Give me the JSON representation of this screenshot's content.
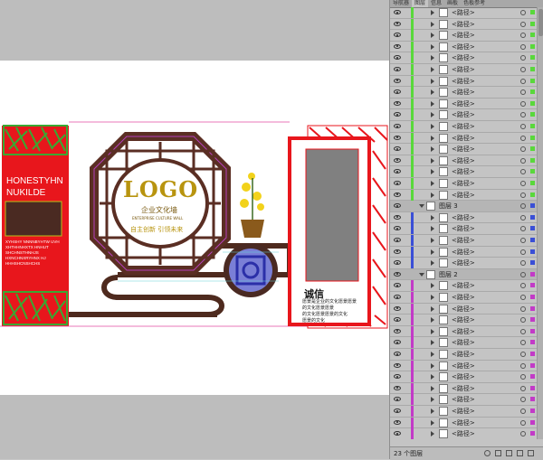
{
  "panel": {
    "tabs": [
      "导航器",
      "图层",
      "信息",
      "画板",
      "色板参考"
    ],
    "active_tab": "图层",
    "layer_count": "23 个图层",
    "path_label": "<路径>",
    "groups": [
      {
        "label": "图层 3"
      },
      {
        "label": "图层 2"
      }
    ],
    "colors": {
      "layer1": "#59d83b",
      "layer3": "#3a4fd6",
      "layer2": "#c23ac7"
    }
  },
  "artwork": {
    "left_panel_title_line1": "HONESTYHN",
    "left_panel_title_line2": "NUKILDE",
    "left_panel_small_text": [
      "XYHSHY NNNNBYHTW UVH",
      "XHTHHNHXTX HNHUT",
      "SHCHNSTHNHJS",
      "HXNCHNXRYHNX HJ",
      "HHHSHCNSHCHS"
    ],
    "logo": "LOGO",
    "logo_sub": "企业文化墙",
    "logo_en": "ENTERPRISE CULTURE WALL",
    "logo_slogan": "自主创新 引领未来",
    "right_heading": "诚信",
    "right_lines": [
      "愿景是企业的文化愿景愿景",
      "的文化愿景愿景",
      "的文化愿景愿景的文化",
      "愿景的文化"
    ]
  }
}
